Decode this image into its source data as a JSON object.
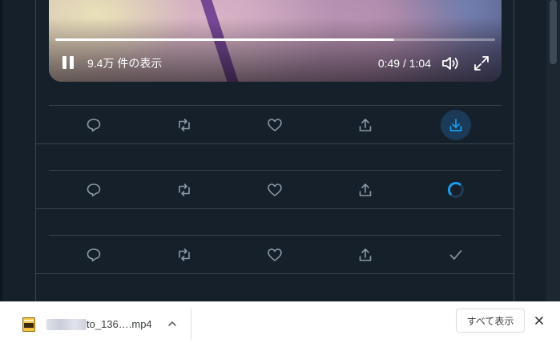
{
  "video": {
    "views_label": "9.4万 件の表示",
    "time_label": "0:49 / 1:04",
    "progress": 0.77
  },
  "action_rows": [
    {
      "status": "download-active"
    },
    {
      "status": "downloading"
    },
    {
      "status": "downloaded"
    }
  ],
  "icons": {
    "reply": "reply-icon",
    "retweet": "retweet-icon",
    "like": "like-icon",
    "share": "share-icon",
    "download": "download-icon",
    "spinner": "loading-spinner-icon",
    "done": "checkmark-icon"
  },
  "download_shelf": {
    "file_name": "to_136….mp4",
    "show_all_label": "すべて表示"
  },
  "colors": {
    "background": "#15202b",
    "divider": "#38444d",
    "icon": "#8b98a5",
    "accent": "#1d9bf0",
    "shelf": "#ffffff"
  }
}
